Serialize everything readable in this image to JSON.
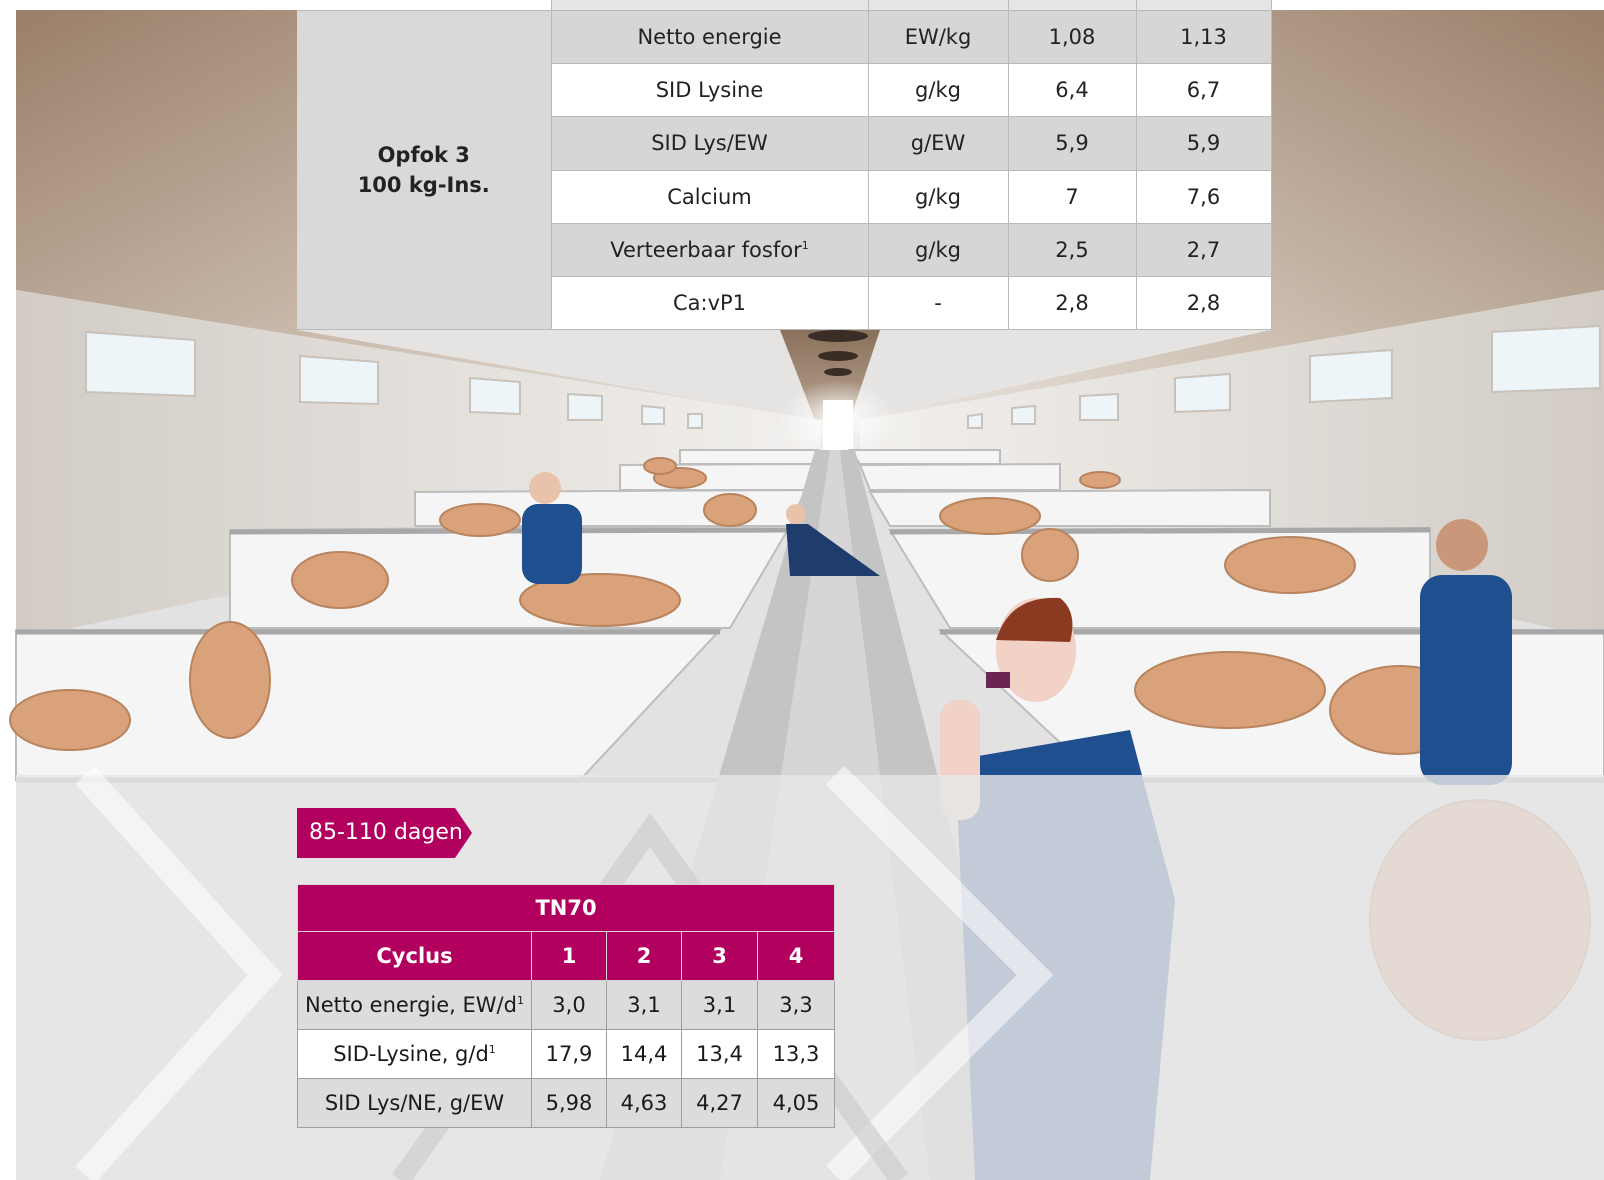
{
  "top_table": {
    "group_label_line1": "Opfok 3",
    "group_label_line2": "100 kg-Ins.",
    "rows": [
      {
        "param": "Netto energie",
        "unit": "EW/kg",
        "v1": "1,08",
        "v2": "1,13"
      },
      {
        "param": "SID Lysine",
        "unit": "g/kg",
        "v1": "6,4",
        "v2": "6,7"
      },
      {
        "param": "SID Lys/EW",
        "unit": "g/EW",
        "v1": "5,9",
        "v2": "5,9"
      },
      {
        "param": "Calcium",
        "unit": "g/kg",
        "v1": "7",
        "v2": "7,6"
      },
      {
        "param": "Verteerbaar fosfor",
        "param_sup": "1",
        "unit": "g/kg",
        "v1": "2,5",
        "v2": "2,7"
      },
      {
        "param": "Ca:vP1",
        "unit": "-",
        "v1": "2,8",
        "v2": "2,8"
      }
    ]
  },
  "badge": {
    "label": "85-110 dagen",
    "color": "#b2005f"
  },
  "tn70_table": {
    "title": "TN70",
    "header": [
      "Cyclus",
      "1",
      "2",
      "3",
      "4"
    ],
    "rows": [
      {
        "label": "Netto energie, EW/d",
        "sup": "1",
        "values": [
          "3,0",
          "3,1",
          "3,1",
          "3,3"
        ]
      },
      {
        "label": "SID-Lysine, g/d",
        "sup": "1",
        "values": [
          "17,9",
          "14,4",
          "13,4",
          "13,3"
        ]
      },
      {
        "label": "SID Lys/NE, g/EW",
        "values": [
          "5,98",
          "4,63",
          "4,27",
          "4,05"
        ]
      }
    ],
    "header_color": "#b2005f"
  },
  "colors": {
    "pig": "#d9a27a",
    "shirt": "#1f4f8f",
    "ceiling": "#a88f79",
    "floor": "#e4e4e4"
  }
}
